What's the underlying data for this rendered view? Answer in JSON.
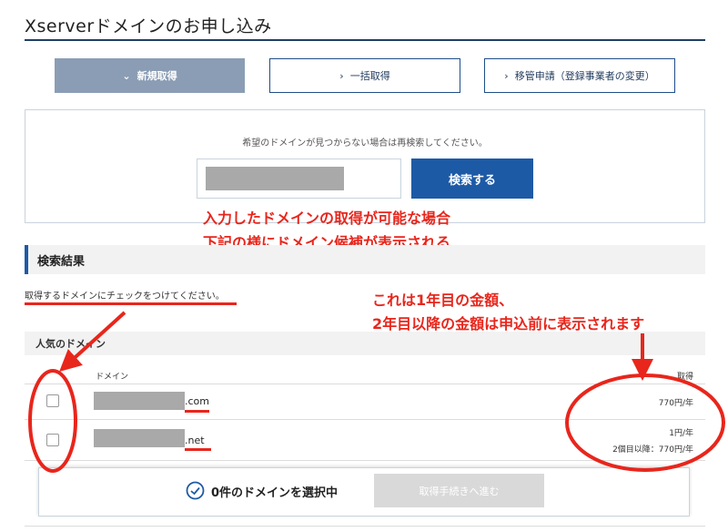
{
  "page": {
    "title": "Xserverドメインのお申し込み"
  },
  "tabs": [
    {
      "label": "新規取得",
      "icon": "chevron-down-icon",
      "active": true
    },
    {
      "label": "一括取得",
      "icon": "chevron-right-icon",
      "active": false
    },
    {
      "label": "移管申請（登録事業者の変更）",
      "icon": "chevron-right-icon",
      "active": false
    }
  ],
  "search": {
    "hint": "希望のドメインが見つからない場合は再検索してください。",
    "button_label": "検索する"
  },
  "annotations": {
    "note1": "入力したドメインの取得が可能な場合",
    "note2": "下記の様にドメイン候補が表示される",
    "note3": "これは1年目の金額、",
    "note4": "2年目以降の金額は申込前に表示されます"
  },
  "results": {
    "heading": "検索結果",
    "instruction": "取得するドメインにチェックをつけてください。",
    "popular_heading": "人気のドメイン",
    "columns": {
      "domain": "ドメイン",
      "price": "取得"
    },
    "rows": [
      {
        "tld": ".com",
        "price_line1": "770円/年",
        "price_line2": ""
      },
      {
        "tld": ".net",
        "price_line1": "1円/年",
        "price_line2": "2個目以降：770円/年"
      }
    ]
  },
  "footer": {
    "selected_text": "0件のドメインを選択中",
    "proceed_label": "取得手続きへ進む"
  },
  "colors": {
    "accent": "#1d5aa6",
    "annotation_red": "#e8261c",
    "active_tab": "#8a9db4"
  }
}
